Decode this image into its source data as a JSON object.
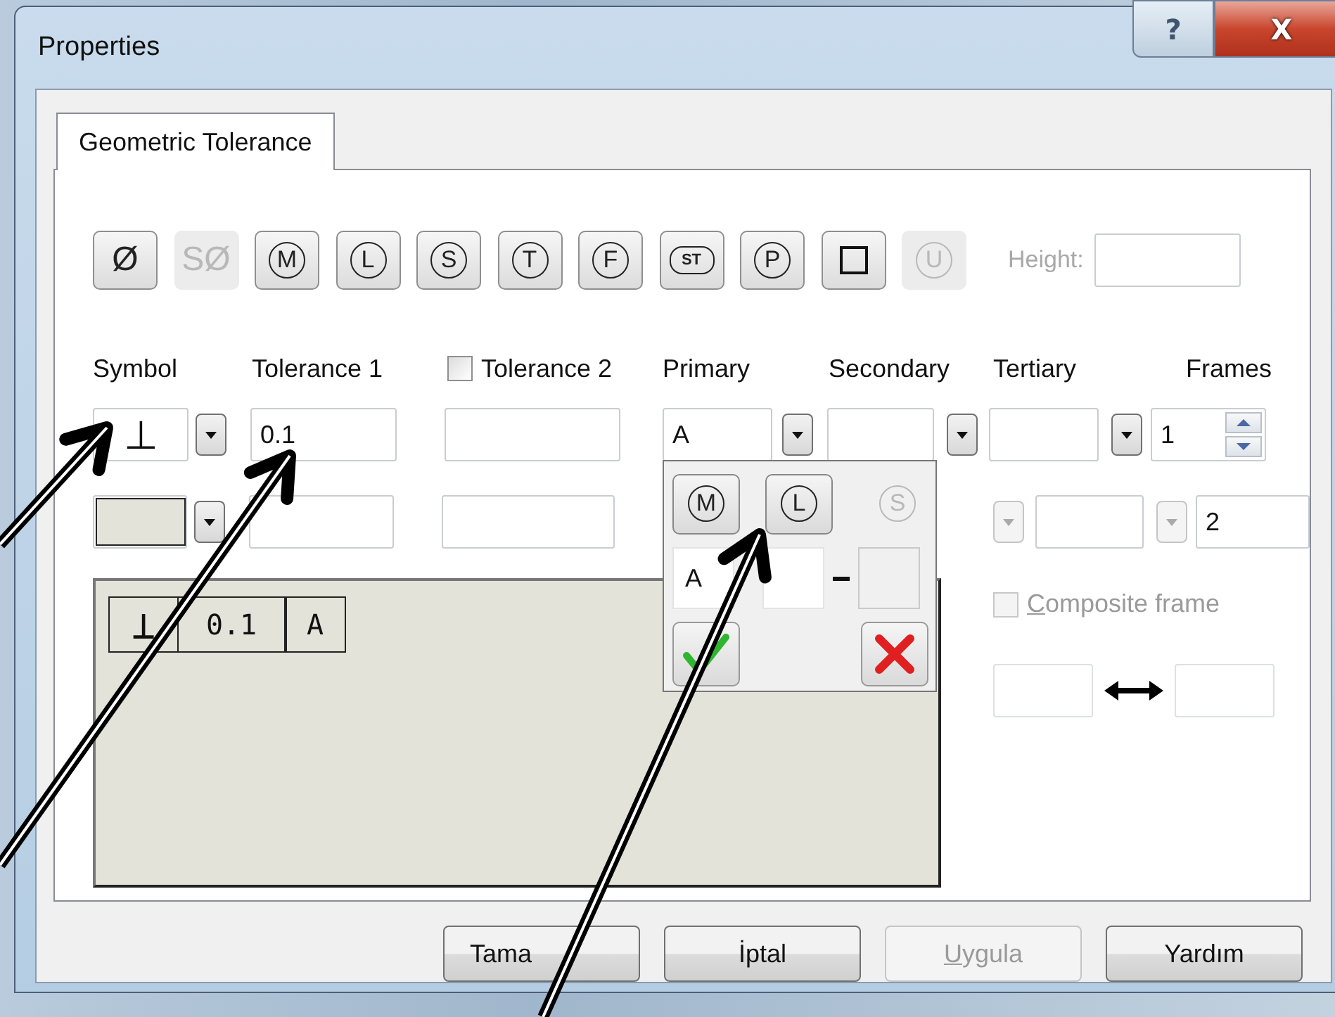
{
  "window": {
    "title": "Properties"
  },
  "title_buttons": [
    {
      "kind": "help",
      "label": "?"
    },
    {
      "kind": "close",
      "label": "X"
    }
  ],
  "tabs": [
    {
      "label": "Geometric Tolerance",
      "selected": true
    }
  ],
  "symbol_buttons": [
    {
      "kind": "plain",
      "label": "Ø",
      "disabled": false
    },
    {
      "kind": "plain",
      "label": "SØ",
      "disabled": true
    },
    {
      "kind": "circled",
      "label": "M",
      "disabled": false
    },
    {
      "kind": "circled",
      "label": "L",
      "disabled": false
    },
    {
      "kind": "circled",
      "label": "S",
      "disabled": false
    },
    {
      "kind": "circled",
      "label": "T",
      "disabled": false
    },
    {
      "kind": "circled",
      "label": "F",
      "disabled": false
    },
    {
      "kind": "flag",
      "label": "ST",
      "disabled": false
    },
    {
      "kind": "circled",
      "label": "P",
      "disabled": false
    },
    {
      "kind": "square",
      "disabled": false
    },
    {
      "kind": "circled",
      "label": "U",
      "disabled": true
    }
  ],
  "height": {
    "label": "Height:"
  },
  "columns": [
    {
      "label": "Symbol"
    },
    {
      "label": "Tolerance 1"
    },
    {
      "label": "Tolerance 2",
      "checked": false
    },
    {
      "label": "Primary"
    },
    {
      "label": "Secondary"
    },
    {
      "label": "Tertiary"
    },
    {
      "label": "Frames"
    }
  ],
  "rows": [
    {
      "symbol": "⊥",
      "tolerance_1": "0.1",
      "primary": "A",
      "frames": "1",
      "datum_dropdowns_disabled": false,
      "spinner": true
    },
    {
      "symbol_swatch": true,
      "frames": "2",
      "datum_dropdowns_disabled": true,
      "spinner": false
    }
  ],
  "preview": {
    "cells": [
      "⊥",
      "0.1",
      "A"
    ]
  },
  "popup": {
    "modifiers": [
      {
        "label": "M",
        "disabled": false
      },
      {
        "label": "L",
        "disabled": false
      },
      {
        "label": "S",
        "disabled": true
      }
    ],
    "datum": "A"
  },
  "composite_frame": {
    "label": "Composite frame",
    "checked": false
  },
  "buttons": [
    {
      "label": "Tama",
      "disabled": false
    },
    {
      "label": "İptal",
      "disabled": false
    },
    {
      "label": "Uygula",
      "disabled": true,
      "mnemonic": true
    },
    {
      "label": "Yardım",
      "disabled": false
    }
  ]
}
